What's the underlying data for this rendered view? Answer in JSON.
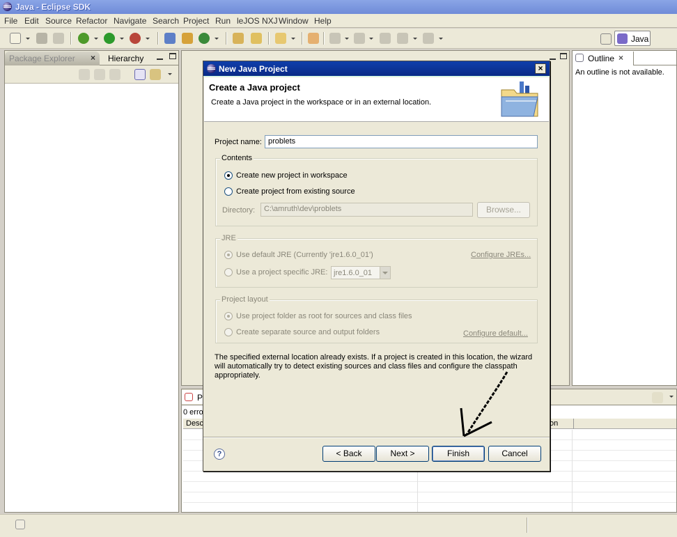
{
  "window": {
    "title": "Java - Eclipse SDK"
  },
  "menubar": [
    "File",
    "Edit",
    "Source",
    "Refactor",
    "Navigate",
    "Search",
    "Project",
    "Run",
    "leJOS NXJ",
    "Window",
    "Help"
  ],
  "perspective": {
    "label": "Java"
  },
  "left_panel": {
    "tabs": [
      "Package Explorer",
      "Hierarchy"
    ]
  },
  "outline": {
    "tab": "Outline",
    "message": "An outline is not available."
  },
  "problems": {
    "tab": "P",
    "summary": "0 erro",
    "col_desc": "Desc",
    "col_location": "on"
  },
  "dialog": {
    "title": "New Java Project",
    "header_title": "Create a Java project",
    "header_desc": "Create a Java project in the workspace or in an external location.",
    "project_name_label": "Project name:",
    "project_name_value": "problets",
    "contents": {
      "label": "Contents",
      "option_new": "Create new project in workspace",
      "option_existing": "Create project from existing source",
      "directory_label": "Directory:",
      "directory_value": "C:\\amruth\\dev\\problets",
      "browse": "Browse..."
    },
    "jre": {
      "label": "JRE",
      "option_default": "Use default JRE (Currently 'jre1.6.0_01')",
      "configure": "Configure JREs...",
      "option_specific": "Use a project specific JRE:",
      "combo_value": "jre1.6.0_01"
    },
    "layout": {
      "label": "Project layout",
      "option_root": "Use project folder as root for sources and class files",
      "option_separate": "Create separate source and output folders",
      "configure": "Configure default..."
    },
    "message": "The specified external location already exists. If a project is created in this location, the wizard will automatically try to detect existing sources and class files and configure the classpath appropriately.",
    "help_glyph": "?",
    "buttons": {
      "back": "< Back",
      "next": "Next >",
      "finish": "Finish",
      "cancel": "Cancel"
    }
  }
}
